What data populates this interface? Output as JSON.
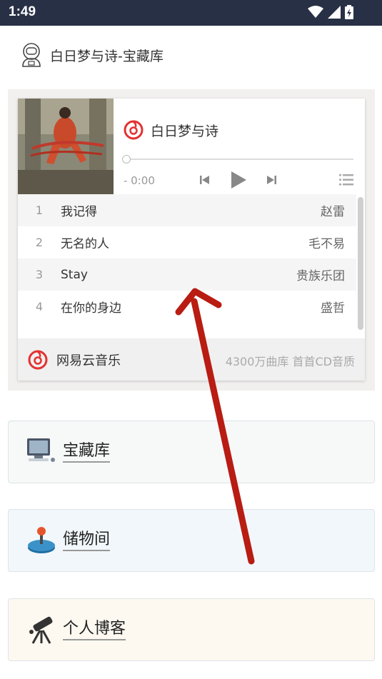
{
  "status_bar": {
    "time": "1:49"
  },
  "header": {
    "title": "白日梦与诗-宝藏库"
  },
  "player": {
    "song_title": "白日梦与诗",
    "time": "- 0:00",
    "tracks": [
      {
        "no": "1",
        "name": "我记得",
        "artist": "赵雷"
      },
      {
        "no": "2",
        "name": "无名的人",
        "artist": "毛不易"
      },
      {
        "no": "3",
        "name": "Stay",
        "artist": "贵族乐团"
      },
      {
        "no": "4",
        "name": "在你的身边",
        "artist": "盛哲"
      }
    ],
    "footer_name": "网易云音乐",
    "footer_tag": "4300万曲库 首首CD音质",
    "progress": 0
  },
  "cards": [
    {
      "label": "宝藏库",
      "icon": "computer-icon",
      "bg": "#f7f9f9"
    },
    {
      "label": "储物间",
      "icon": "joystick-icon",
      "bg": "#f2f7fb"
    },
    {
      "label": "个人博客",
      "icon": "telescope-icon",
      "bg": "#fdf9f1"
    }
  ],
  "colors": {
    "status_bar": "#283046",
    "netease_red": "#e33231",
    "arrow": "#b81c12"
  }
}
